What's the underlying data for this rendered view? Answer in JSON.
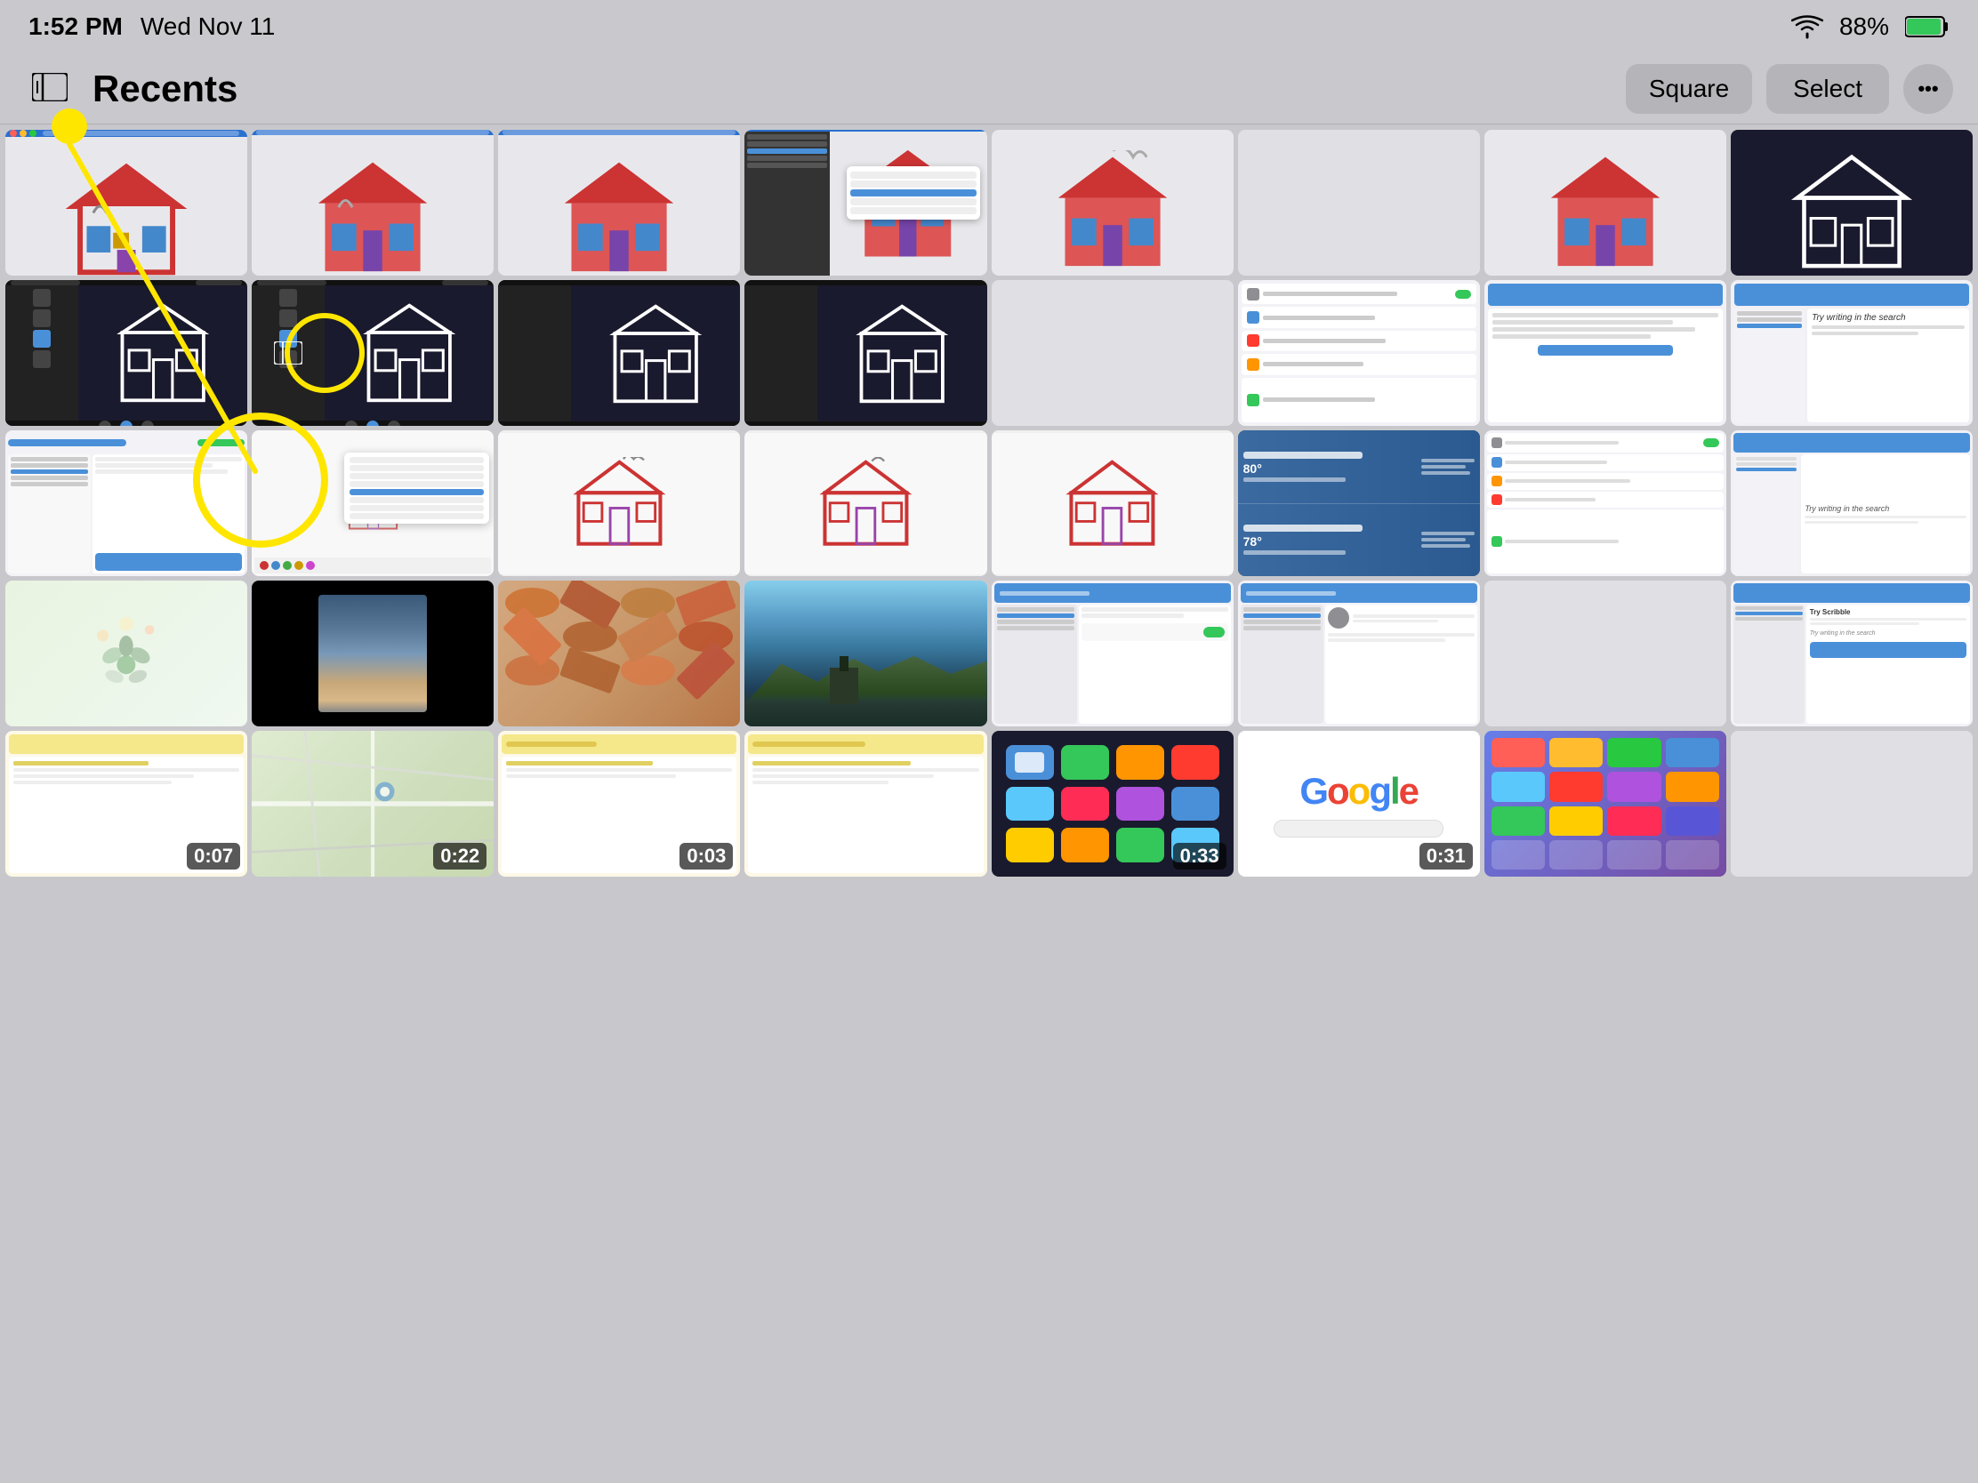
{
  "status_bar": {
    "time": "1:52 PM",
    "date": "Wed Nov 11",
    "wifi_label": "wifi",
    "battery_percent": "88%"
  },
  "nav_bar": {
    "sidebar_icon": "sidebar",
    "title": "Recents",
    "btn_square": "Square",
    "btn_select": "Select",
    "btn_more": "•••"
  },
  "annotation": {
    "yellow_dot_visible": true,
    "yellow_circle_visible": true,
    "arrow_visible": true
  },
  "grid": {
    "rows": [
      {
        "row_index": 1,
        "cells": [
          {
            "type": "house_light",
            "row_span": 1
          },
          {
            "type": "house_light",
            "row_span": 1
          },
          {
            "type": "house_light",
            "row_span": 1
          },
          {
            "type": "house_light_menu",
            "row_span": 1
          },
          {
            "type": "house_light",
            "row_span": 1
          },
          {
            "type": "house_light",
            "row_span": 1
          },
          {
            "type": "house_light",
            "row_span": 1
          },
          {
            "type": "house_dark",
            "row_span": 1
          }
        ]
      },
      {
        "row_index": 2,
        "cells": [
          {
            "type": "dark_scribble",
            "row_span": 1
          },
          {
            "type": "dark_scribble_highlight",
            "row_span": 1
          },
          {
            "type": "dark_scribble",
            "row_span": 1
          },
          {
            "type": "dark_scribble",
            "row_span": 1
          },
          {
            "type": "empty",
            "row_span": 1
          },
          {
            "type": "settings_apple",
            "row_span": 1
          },
          {
            "type": "try_scribble_white",
            "row_span": 1
          },
          {
            "type": "try_scribble_white2",
            "row_span": 1
          }
        ]
      },
      {
        "row_index": 3,
        "cells": [
          {
            "type": "settings_light",
            "row_span": 1
          },
          {
            "type": "white_menu",
            "row_span": 1
          },
          {
            "type": "house_light_simple",
            "row_span": 1
          },
          {
            "type": "house_light_simple2",
            "row_span": 1
          },
          {
            "type": "house_light_simple3",
            "row_span": 1
          },
          {
            "type": "weather_card",
            "row_span": 1
          },
          {
            "type": "settings_apple2",
            "row_span": 1
          },
          {
            "type": "try_scribble_white3",
            "row_span": 1
          }
        ]
      },
      {
        "row_index": 4,
        "cells": [
          {
            "type": "flowers_watercolor",
            "row_span": 1
          },
          {
            "type": "black_portrait",
            "row_span": 1
          },
          {
            "type": "autumn_leaves",
            "row_span": 1
          },
          {
            "type": "lake_photo",
            "row_span": 1
          },
          {
            "type": "settings_ipad",
            "row_span": 1
          },
          {
            "type": "settings_ipad2",
            "row_span": 1
          },
          {
            "type": "empty2",
            "row_span": 1
          },
          {
            "type": "try_scribble_settings",
            "row_span": 1
          }
        ]
      },
      {
        "row_index": 5,
        "cells": [
          {
            "type": "notes_app",
            "duration": "0:07"
          },
          {
            "type": "map_app",
            "duration": "0:22"
          },
          {
            "type": "notes_yellow",
            "duration": "0:03"
          },
          {
            "type": "notes_yellow2"
          },
          {
            "type": "video_dark",
            "duration": "0:33"
          },
          {
            "type": "google_screen",
            "duration": "0:31"
          },
          {
            "type": "homescreen"
          }
        ]
      }
    ]
  },
  "video_badges": {
    "map": "0:22",
    "notes_row5_col1": "0:07",
    "notes_row5_col3": "0:03",
    "dark_video": "0:33",
    "google": "0:31"
  }
}
